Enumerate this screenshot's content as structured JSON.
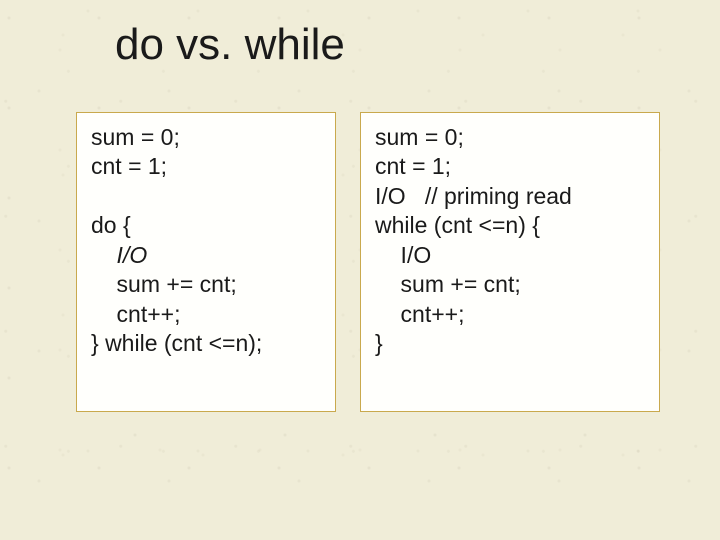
{
  "title": "do vs. while",
  "left": {
    "l1": "sum = 0;",
    "l2": "cnt = 1;",
    "l3": "do {",
    "l4": "    I/O",
    "l5": "    sum += cnt;",
    "l6": "    cnt++;",
    "l7": "} while (cnt <=n);"
  },
  "right": {
    "l1": "sum = 0;",
    "l2": "cnt = 1;",
    "l3": "I/O   // priming read",
    "l4": "while (cnt <=n) {",
    "l5": "    I/O",
    "l6": "    sum += cnt;",
    "l7": "    cnt++;",
    "l8": "}"
  }
}
